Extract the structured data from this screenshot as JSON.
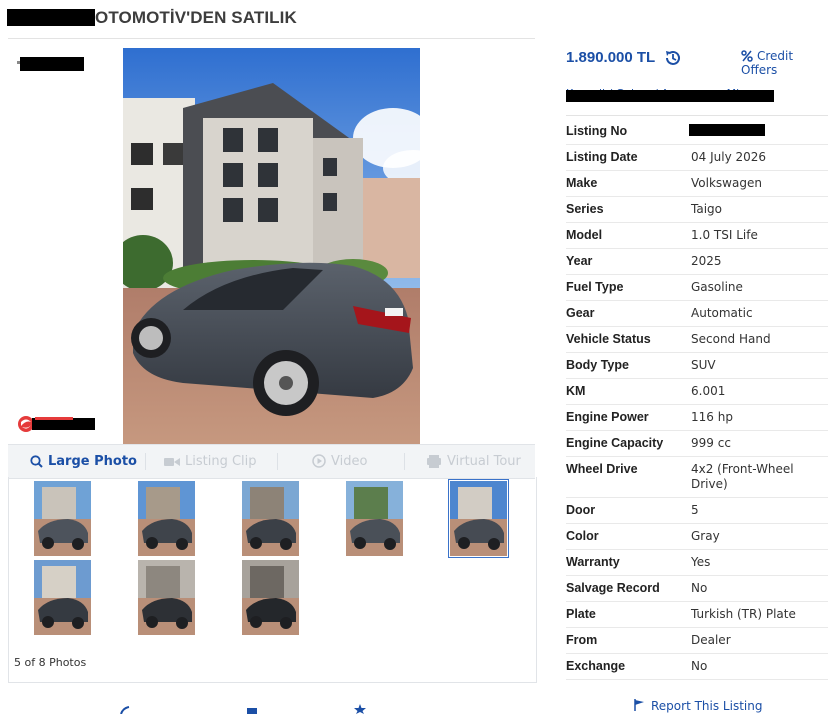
{
  "header": {
    "title": "OTOMOTİV'DEN SATILIK"
  },
  "listing": {
    "price": "1.890.000 TL",
    "credit_offers": "Credit Offers",
    "location": "Kocaeli / Gebze / Arapçeşme Mh."
  },
  "media_tabs": [
    {
      "label": "Large Photo",
      "icon": "search-icon",
      "enabled": true
    },
    {
      "label": "Listing Clip",
      "icon": "video-camera-icon",
      "enabled": false
    },
    {
      "label": "Video",
      "icon": "play-icon",
      "enabled": false
    },
    {
      "label": "Virtual Tour",
      "icon": "tour-icon",
      "enabled": false
    }
  ],
  "gallery": {
    "counter": "5 of 8 Photos",
    "selected_index": 4,
    "thumb_count": 8
  },
  "specs": [
    {
      "key": "Listing No",
      "value": ""
    },
    {
      "key": "Listing Date",
      "value": "04 July 2026"
    },
    {
      "key": "Make",
      "value": "Volkswagen"
    },
    {
      "key": "Series",
      "value": "Taigo"
    },
    {
      "key": "Model",
      "value": "1.0 TSI Life"
    },
    {
      "key": "Year",
      "value": "2025"
    },
    {
      "key": "Fuel Type",
      "value": "Gasoline"
    },
    {
      "key": "Gear",
      "value": "Automatic"
    },
    {
      "key": "Vehicle Status",
      "value": "Second Hand"
    },
    {
      "key": "Body Type",
      "value": "SUV"
    },
    {
      "key": "KM",
      "value": "6.001"
    },
    {
      "key": "Engine Power",
      "value": "116 hp"
    },
    {
      "key": "Engine Capacity",
      "value": "999 cc"
    },
    {
      "key": "Wheel Drive",
      "value": "4x2 (Front-Wheel Drive)"
    },
    {
      "key": "Door",
      "value": "5"
    },
    {
      "key": "Color",
      "value": "Gray"
    },
    {
      "key": "Warranty",
      "value": "Yes"
    },
    {
      "key": "Salvage Record",
      "value": "No"
    },
    {
      "key": "Plate",
      "value": "Turkish (TR) Plate"
    },
    {
      "key": "From",
      "value": "Dealer"
    },
    {
      "key": "Exchange",
      "value": "No"
    }
  ],
  "report": {
    "label": "Report This Listing"
  },
  "colors": {
    "accent": "#1b4fa6",
    "disabled": "#c7ccd2",
    "border": "#e1e4e8"
  }
}
